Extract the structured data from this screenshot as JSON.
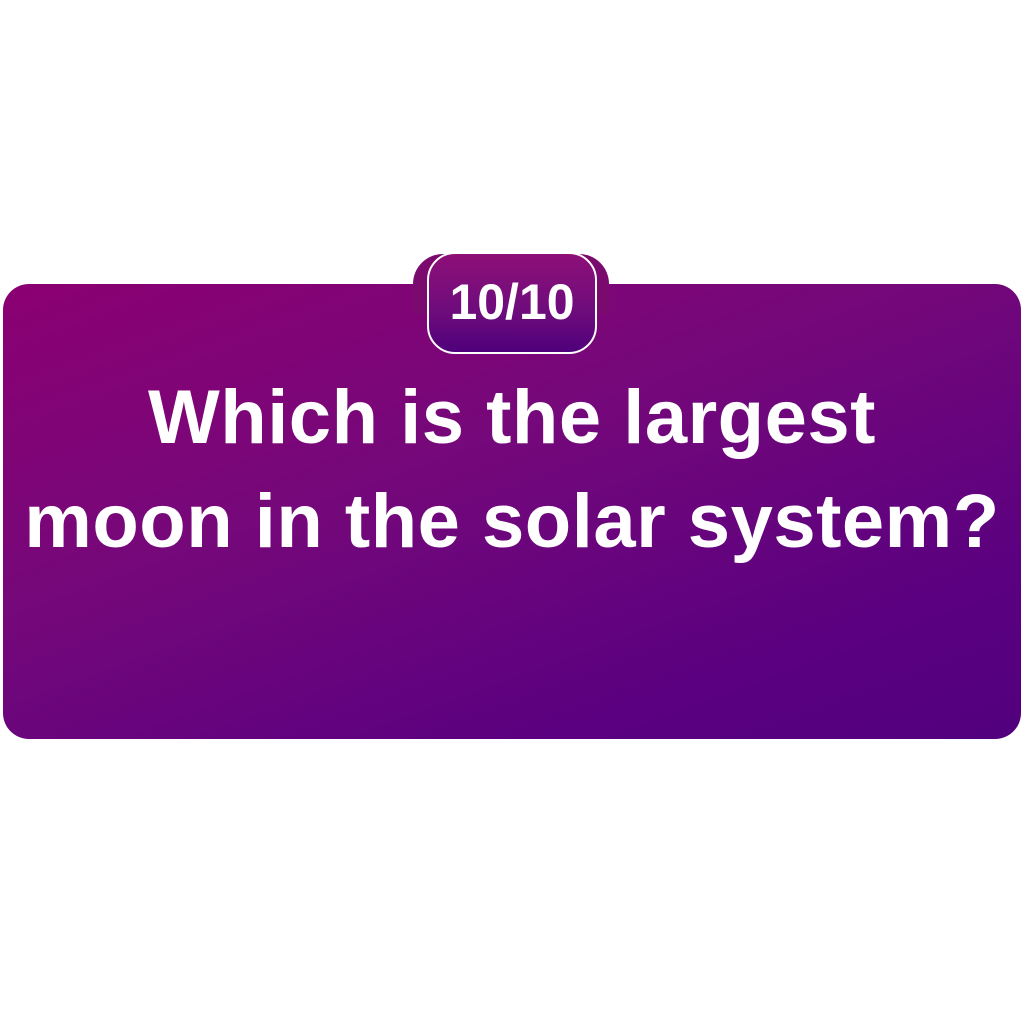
{
  "quiz": {
    "progress": {
      "label": "10/10",
      "current": 10,
      "total": 10
    },
    "question_line1": "Which is the largest",
    "question_line2": "moon in the solar system?"
  },
  "colors": {
    "card_gradient_start": "#8b0072",
    "card_gradient_end": "#52007e",
    "text": "#ffffff",
    "background": "#ffffff"
  }
}
